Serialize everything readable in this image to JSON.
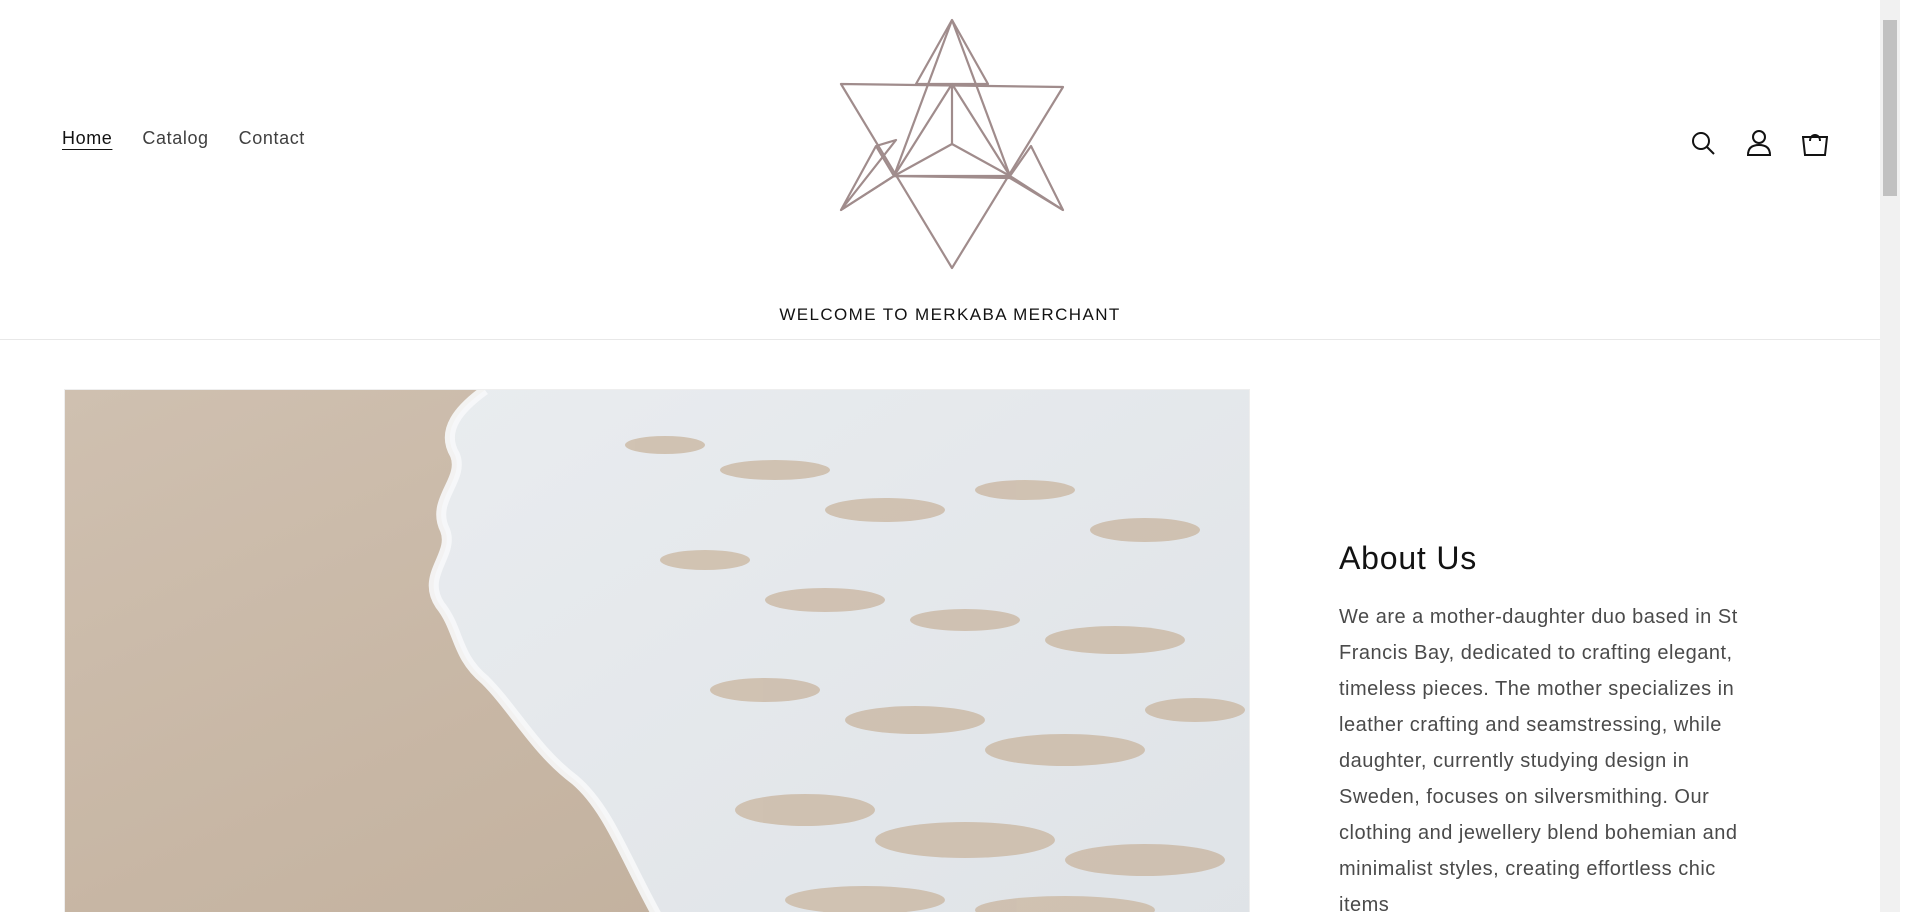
{
  "nav": {
    "items": [
      {
        "label": "Home",
        "active": true
      },
      {
        "label": "Catalog",
        "active": false
      },
      {
        "label": "Contact",
        "active": false
      }
    ]
  },
  "header": {
    "tagline": "WELCOME TO MERKABA MERCHANT",
    "logo_icon": "merkaba-star-logo",
    "logo_color": "#a08c8c"
  },
  "header_icons": [
    "search-icon",
    "account-icon",
    "cart-icon"
  ],
  "about": {
    "title": "About Us",
    "body": "We are a mother-daughter duo based in St Francis Bay, dedicated to crafting elegant, timeless pieces. The mother specializes in leather crafting and seamstressing, while daughter, currently studying design in Sweden, focuses on silversmithing. Our clothing and jewellery blend bohemian and minimalist styles, creating effortless chic items"
  },
  "hero": {
    "image": "beach-wave-photo"
  }
}
